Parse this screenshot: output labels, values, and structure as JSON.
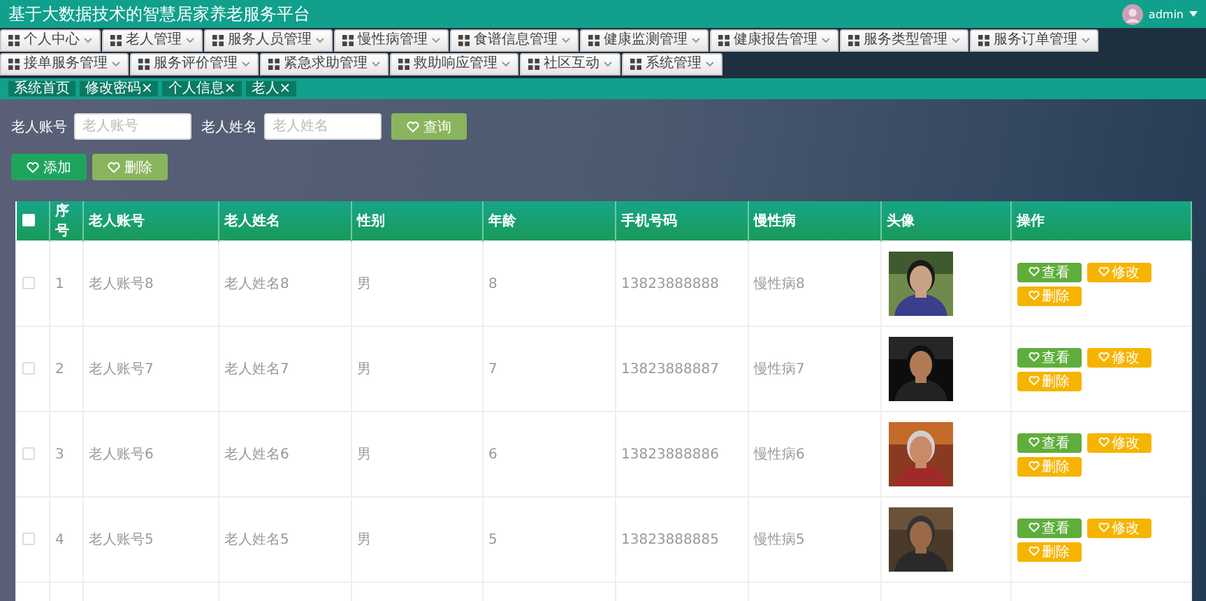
{
  "header": {
    "title": "基于大数据技术的智慧居家养老服务平台",
    "user": "admin"
  },
  "menu": [
    {
      "label": "个人中心"
    },
    {
      "label": "老人管理"
    },
    {
      "label": "服务人员管理"
    },
    {
      "label": "慢性病管理"
    },
    {
      "label": "食谱信息管理"
    },
    {
      "label": "健康监测管理"
    },
    {
      "label": "健康报告管理"
    },
    {
      "label": "服务类型管理"
    },
    {
      "label": "服务订单管理"
    },
    {
      "label": "接单服务管理"
    },
    {
      "label": "服务评价管理"
    },
    {
      "label": "紧急求助管理"
    },
    {
      "label": "救助响应管理"
    },
    {
      "label": "社区互动"
    },
    {
      "label": "系统管理"
    }
  ],
  "tabs": [
    "系统首页",
    "修改密码×",
    "个人信息×",
    "老人×"
  ],
  "search": {
    "fields": [
      {
        "label": "老人账号",
        "placeholder": "老人账号"
      },
      {
        "label": "老人姓名",
        "placeholder": "老人姓名"
      }
    ],
    "button": "查询"
  },
  "actions": [
    {
      "label": "添加",
      "kind": "add"
    },
    {
      "label": "删除",
      "kind": "delete"
    }
  ],
  "table": {
    "all_checked": false,
    "columns": [
      "序号",
      "老人账号",
      "老人姓名",
      "性别",
      "年龄",
      "手机号码",
      "慢性病",
      "头像",
      "操作"
    ],
    "rows": [
      {
        "checked": false,
        "cells": [
          "1",
          "老人账号8",
          "老人姓名8",
          "男",
          "8",
          "13823888888",
          "慢性病8"
        ],
        "photo": {
          "kind": "picture"
        },
        "actions": [
          {
            "label": "查看",
            "kind": "view"
          },
          {
            "label": "修改",
            "kind": "edit"
          },
          {
            "label": "删除",
            "kind": "delete"
          }
        ]
      },
      {
        "checked": false,
        "cells": [
          "2",
          "老人账号7",
          "老人姓名7",
          "男",
          "7",
          "13823888887",
          "慢性病7"
        ],
        "photo": {
          "kind": "picture"
        },
        "actions": [
          {
            "label": "查看",
            "kind": "view"
          },
          {
            "label": "修改",
            "kind": "edit"
          },
          {
            "label": "删除",
            "kind": "delete"
          }
        ]
      },
      {
        "checked": false,
        "cells": [
          "3",
          "老人账号6",
          "老人姓名6",
          "男",
          "6",
          "13823888886",
          "慢性病6"
        ],
        "photo": {
          "kind": "picture"
        },
        "actions": [
          {
            "label": "查看",
            "kind": "view"
          },
          {
            "label": "修改",
            "kind": "edit"
          },
          {
            "label": "删除",
            "kind": "delete"
          }
        ]
      },
      {
        "checked": false,
        "cells": [
          "4",
          "老人账号5",
          "老人姓名5",
          "男",
          "5",
          "13823888885",
          "慢性病5"
        ],
        "photo": {
          "kind": "picture"
        },
        "actions": [
          {
            "label": "查看",
            "kind": "view"
          },
          {
            "label": "修改",
            "kind": "edit"
          },
          {
            "label": "删除",
            "kind": "delete"
          }
        ]
      }
    ]
  }
}
